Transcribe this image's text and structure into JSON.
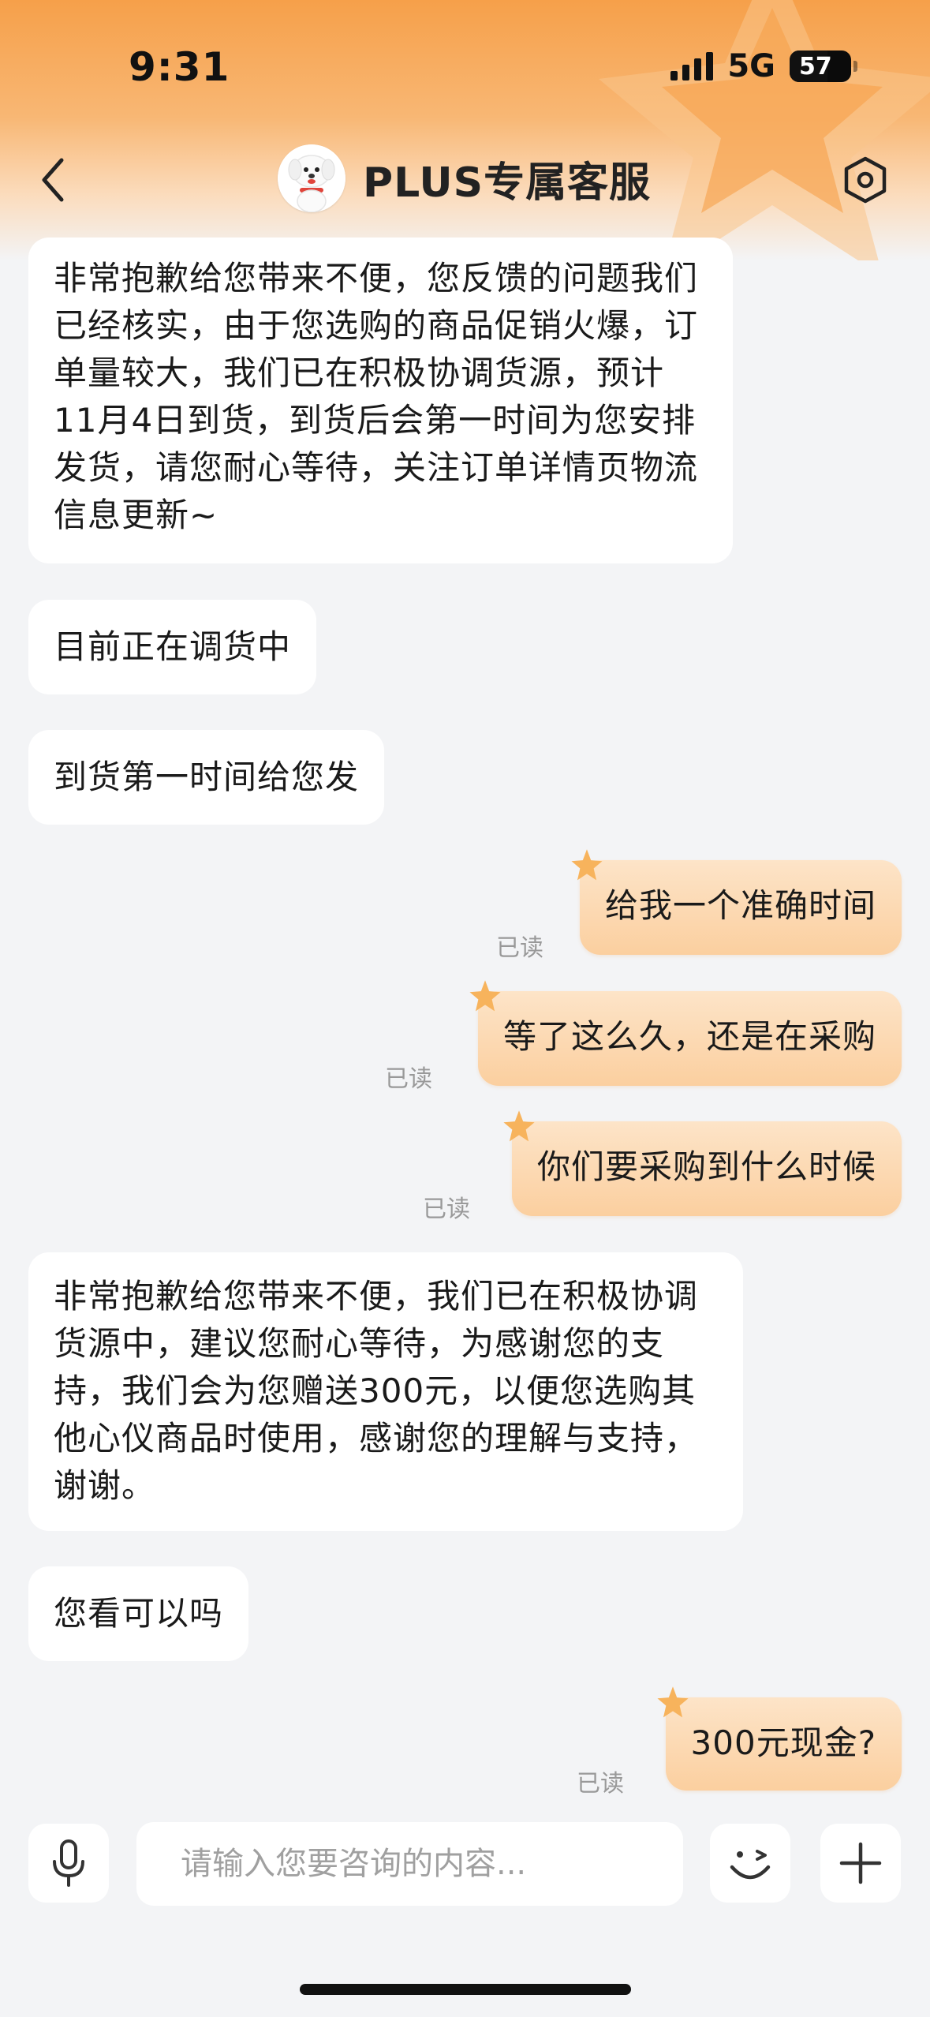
{
  "status_bar": {
    "time": "9:31",
    "network": "5G",
    "battery": "57",
    "battery_level": 0.57
  },
  "header": {
    "title": "PLUS专属客服",
    "back_icon": "chevron-left-icon",
    "settings_icon": "hexagon-settings-icon",
    "avatar_icon": "joy-dog-avatar-icon"
  },
  "messages": [
    {
      "side": "left",
      "text": "非常抱歉给您带来不便，您反馈的问题我们已经核实，由于您选购的商品促销火爆，订单量较大，我们已在积极协调货源，预计11月4日到货，到货后会第一时间为您安排发货，请您耐心等待，关注订单详情页物流信息更新~"
    },
    {
      "side": "left",
      "text": "目前正在调货中"
    },
    {
      "side": "left",
      "text": "到货第一时间给您发"
    },
    {
      "side": "right",
      "text": "给我一个准确时间",
      "status": "已读"
    },
    {
      "side": "right",
      "text": "等了这么久，还是在采购",
      "status": "已读"
    },
    {
      "side": "right",
      "text": "你们要采购到什么时候",
      "status": "已读"
    },
    {
      "side": "left",
      "text": "非常抱歉给您带来不便，我们已在积极协调货源中，建议您耐心等待，为感谢您的支持，我们会为您赠送300元，以便您选购其他心仪商品时使用，感谢您的理解与支持，谢谢。"
    },
    {
      "side": "left",
      "text": "您看可以吗"
    },
    {
      "side": "right",
      "text": "300元现金?",
      "status": "已读"
    }
  ],
  "input_bar": {
    "placeholder": "请输入您要咨询的内容...",
    "value": "",
    "mic_icon": "microphone-icon",
    "emoji_icon": "wink-emoji-icon",
    "plus_icon": "plus-icon"
  },
  "colors": {
    "accent": "#f6a04a",
    "bubble_right": "#fbcf9f",
    "background": "#f3f4f6"
  }
}
